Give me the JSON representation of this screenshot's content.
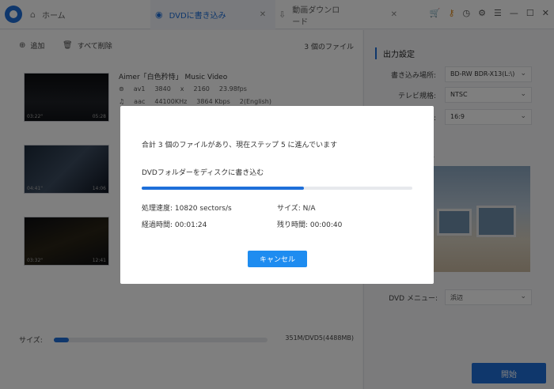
{
  "app": {
    "tabs": [
      {
        "label": "ホーム"
      },
      {
        "label": "DVDに書き込み"
      },
      {
        "label": "動画ダウンロード"
      }
    ]
  },
  "toolbar": {
    "add_label": "追加",
    "delete_all_label": "すべて削除",
    "file_count": "3 個のファイル"
  },
  "files": [
    {
      "title": "Aimer「白色矜恃」 Music Video",
      "video": [
        "av1",
        "3840",
        "x",
        "2160",
        "23.98fps"
      ],
      "audio": [
        "aac",
        "44100KHz",
        "3864 Kbps",
        "2(English)"
      ],
      "time_start": "03:22\"",
      "time_end": "05:28"
    },
    {
      "time_start": "04:41\"",
      "time_end": "14:06"
    },
    {
      "time_start": "03:32\"",
      "time_end": "12:41"
    }
  ],
  "size": {
    "label": "サイズ:",
    "value": "351M/DVD5(4488MB)",
    "fill_percent": 7
  },
  "settings": {
    "title": "出力設定",
    "burn_location_label": "書き込み場所:",
    "burn_location_value": "BD-RW  BDR-X13(L:\\)",
    "tv_standard_label": "テレビ規格:",
    "tv_standard_value": "NTSC",
    "aspect_label": "比:",
    "aspect_value": "16:9",
    "template_title": "ート",
    "menu_label": "DVD メニュー:",
    "menu_value": "浜辺",
    "start_label": "開始"
  },
  "dialog": {
    "message": "合計 3 個のファイルがあり、現在ステップ 5 に進んでいます",
    "task": "DVDフォルダーをディスクに書き込む",
    "progress_percent": 60,
    "speed": "処理速度: 10820 sectors/s",
    "size": "サイズ: N/A",
    "elapsed": "経過時間: 00:01:24",
    "remaining": "残り時間: 00:00:40",
    "cancel_label": "キャンセル"
  },
  "colors": {
    "accent": "#1e6fd9",
    "cancel": "#1e8cf0"
  }
}
